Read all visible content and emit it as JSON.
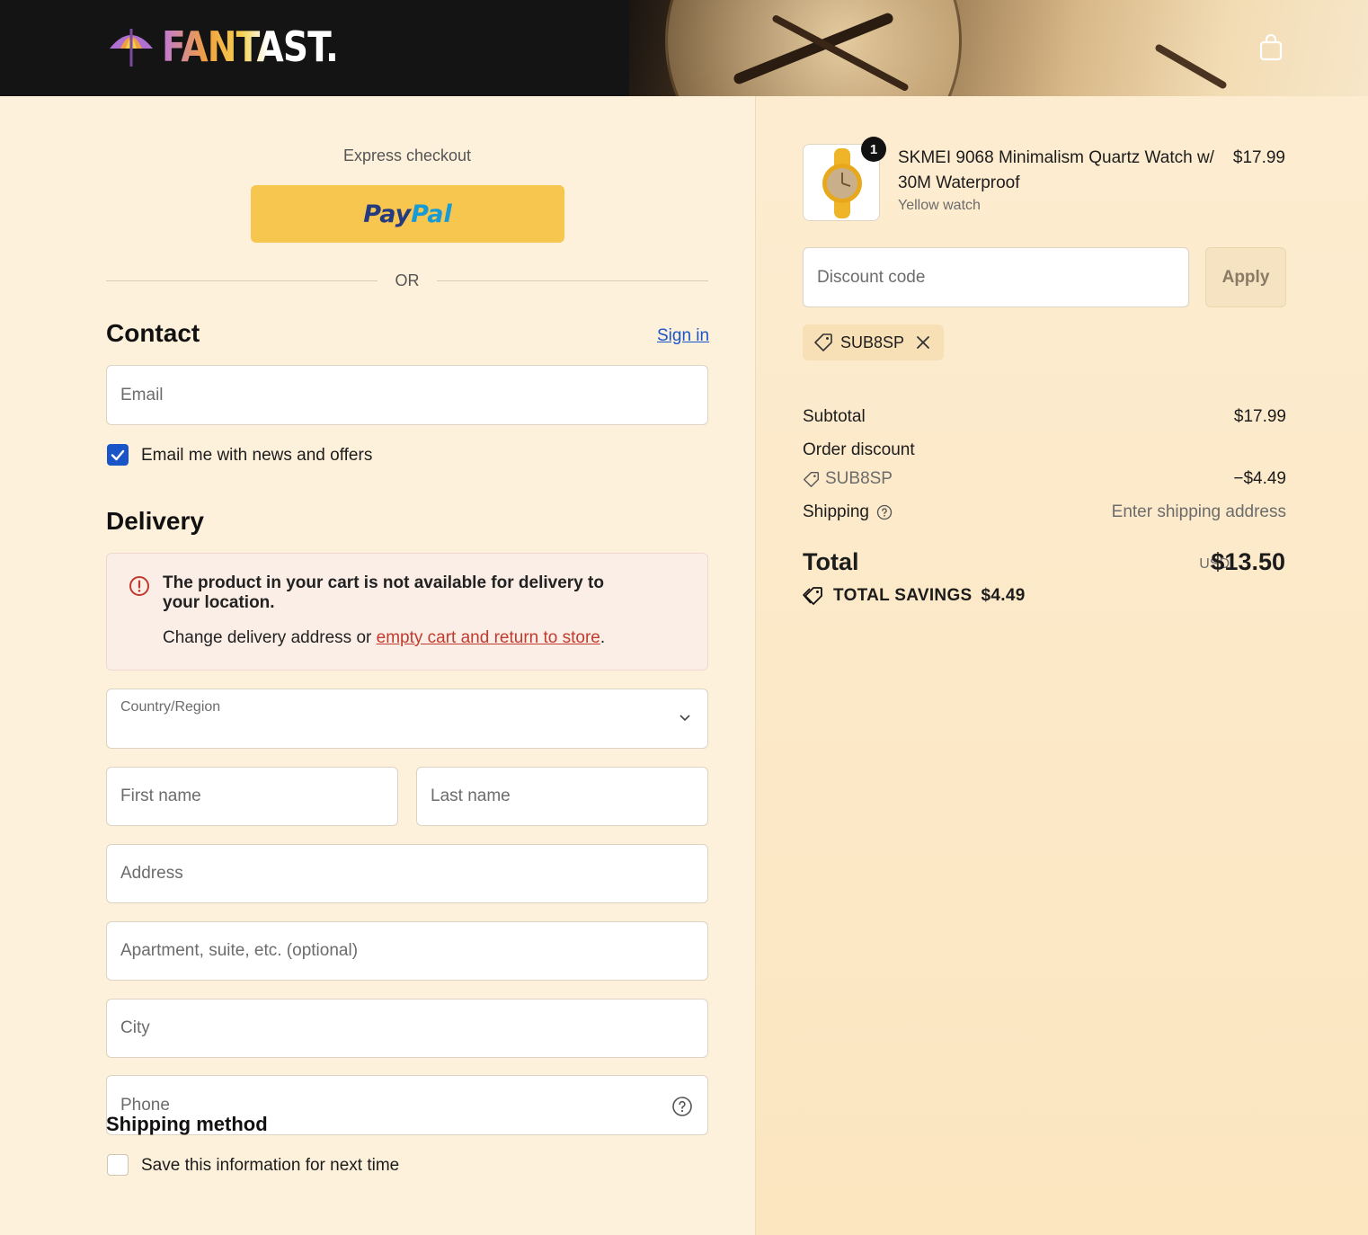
{
  "header": {
    "brand": "FANTAST.",
    "cart_icon": "shopping-bag-icon"
  },
  "express": {
    "label": "Express checkout",
    "paypal_part1": "Pay",
    "paypal_part2": "Pal",
    "or_text": "OR"
  },
  "contact": {
    "title": "Contact",
    "sign_in": "Sign in",
    "email_placeholder": "Email",
    "newsletter_label": "Email me with news and offers",
    "newsletter_checked": true
  },
  "delivery": {
    "title": "Delivery",
    "alert_title": "The product in your cart is not available for delivery to your location.",
    "alert_body_prefix": "Change delivery address or ",
    "alert_link": "empty cart and return to store",
    "alert_body_suffix": ".",
    "country_label": "Country/Region",
    "first_name": "First name",
    "last_name": "Last name",
    "address": "Address",
    "apartment": "Apartment, suite, etc. (optional)",
    "city": "City",
    "phone": "Phone",
    "save_info_label": "Save this information for next time",
    "save_info_checked": false
  },
  "shipping_method": {
    "title": "Shipping method"
  },
  "order": {
    "item": {
      "quantity": "1",
      "name": "SKMEI 9068 Minimalism Quartz Watch w/ 30M Waterproof",
      "variant": "Yellow watch",
      "price": "$17.99"
    },
    "discount_placeholder": "Discount code",
    "apply_label": "Apply",
    "applied_code": "SUB8SP",
    "subtotal_label": "Subtotal",
    "subtotal_value": "$17.99",
    "order_discount_label": "Order discount",
    "order_discount_code": "SUB8SP",
    "order_discount_value": "−$4.49",
    "shipping_label": "Shipping",
    "shipping_value": "Enter shipping address",
    "total_label": "Total",
    "total_currency": "USD",
    "total_value": "$13.50",
    "savings_label": "TOTAL SAVINGS",
    "savings_value": "$4.49"
  },
  "colors": {
    "accent": "#1a55c8",
    "paypal": "#f6c64f",
    "error": "#c23a2e"
  }
}
